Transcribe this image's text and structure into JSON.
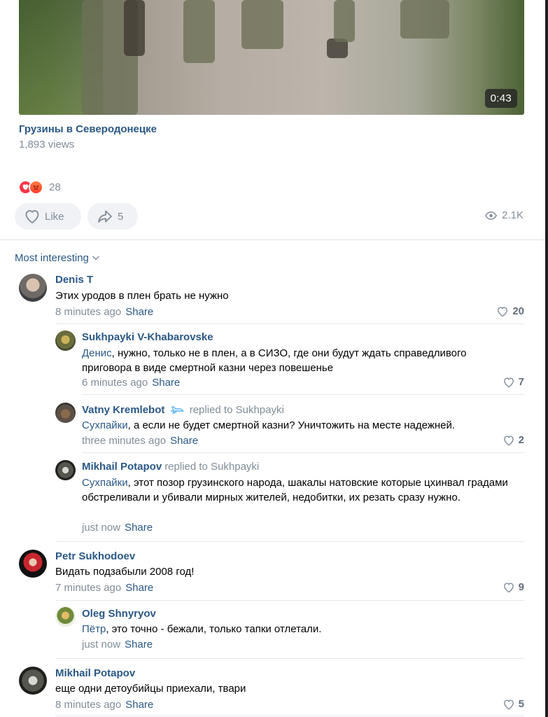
{
  "video": {
    "duration": "0:43",
    "title": "Грузины в Северодонецке",
    "views": "1,893 views"
  },
  "reactions": {
    "count": "28",
    "icons": [
      "heart-reaction-icon",
      "angry-reaction-icon"
    ],
    "colors": {
      "heart": "#ff3347",
      "angry": "#ff5b2e"
    }
  },
  "actions": {
    "like_label": "Like",
    "share_count": "5",
    "views_count": "2.1K"
  },
  "comments_header": {
    "sort_label": "Most interesting"
  },
  "comments": [
    {
      "author": "Denis T",
      "text": "Этих уродов в плен брать не нужно",
      "time": "8 minutes ago",
      "share": "Share",
      "likes": "20"
    },
    {
      "author": "Sukhpayki V-Khabarovske",
      "addressee": "Денис",
      "text": ", нужно, только не в плен, а в СИЗО, где они будут ждать справедливого приговора в виде смертной казни через повешенье",
      "time": "6 minutes ago",
      "share": "Share",
      "likes": "7"
    },
    {
      "author": "Vatny Kremlebot",
      "replied": "replied to Sukhpayki",
      "addressee": "Сухпайки",
      "text": ", а если не будет смертной казни? Уничтожить на месте надежней.",
      "time": "three minutes ago",
      "share": "Share",
      "likes": "2"
    },
    {
      "author": "Mikhail Potapov",
      "replied": "replied to Sukhpayki",
      "addressee": "Сухпайки",
      "text": ", этот позор грузинского народа, шакалы натовские которые цхинвал градами обстреливали и убивали мирных жителей, недобитки, их резать сразу нужно.",
      "time": "just now",
      "share": "Share"
    },
    {
      "author": "Petr Sukhodoev",
      "text": "Видать подзабыли 2008 год!",
      "time": "7 minutes ago",
      "share": "Share",
      "likes": "9"
    },
    {
      "author": "Oleg Shnyryov",
      "addressee": "Пётр",
      "text": ", это точно - бежали, только тапки отлетали.",
      "time": "just now",
      "share": "Share"
    },
    {
      "author": "Mikhail Potapov",
      "text": "еще одни детоубийцы приехали, твари",
      "time": "8 minutes ago",
      "share": "Share",
      "likes": "5"
    }
  ]
}
